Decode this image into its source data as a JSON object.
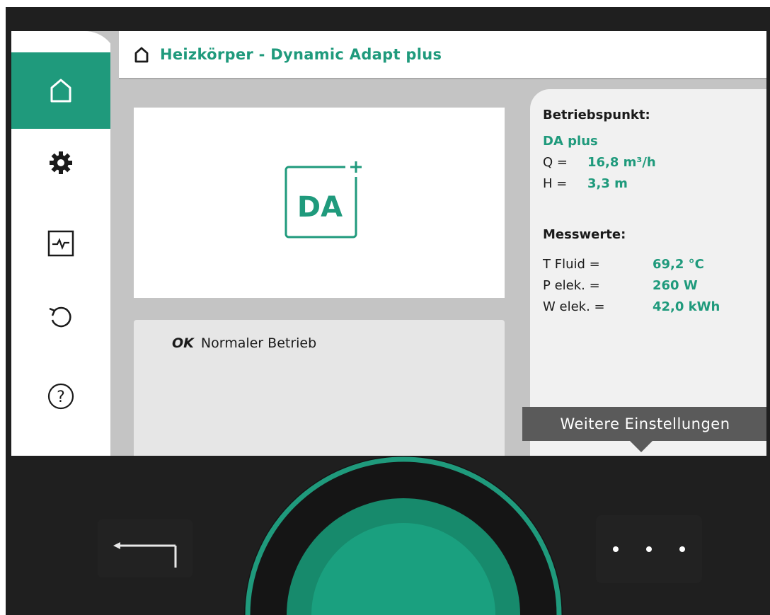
{
  "header": {
    "title": "Heizkörper - Dynamic Adapt plus",
    "icon": "home-icon"
  },
  "sidebar": {
    "items": [
      {
        "name": "home",
        "icon": "home-icon",
        "active": true
      },
      {
        "name": "settings",
        "icon": "gear-icon",
        "active": false
      },
      {
        "name": "diagnostics",
        "icon": "monitor-pulse-icon",
        "active": false
      },
      {
        "name": "restore",
        "icon": "undo-icon",
        "active": false
      },
      {
        "name": "help",
        "icon": "help-icon",
        "active": false
      }
    ]
  },
  "main": {
    "mode_badge": "DA",
    "status": {
      "code": "OK",
      "text": "Normaler Betrieb"
    }
  },
  "info": {
    "operating_point": {
      "heading": "Betriebspunkt:",
      "mode": "DA plus",
      "rows": [
        {
          "label": "Q =",
          "value": "16,8 m³/h"
        },
        {
          "label": "H =",
          "value": "3,3 m"
        }
      ]
    },
    "measurements": {
      "heading": "Messwerte:",
      "rows": [
        {
          "label": "T Fluid =",
          "value": "69,2 °C"
        },
        {
          "label": "P elek. =",
          "value": "260 W"
        },
        {
          "label": "W elek. =",
          "value": "42,0 kWh"
        }
      ]
    }
  },
  "tooltip": {
    "text": "Weitere Einstellungen"
  },
  "colors": {
    "accent": "#1f9a7c",
    "panel_bg": "#c4c4c4",
    "device_bg": "#1f1f1f"
  }
}
